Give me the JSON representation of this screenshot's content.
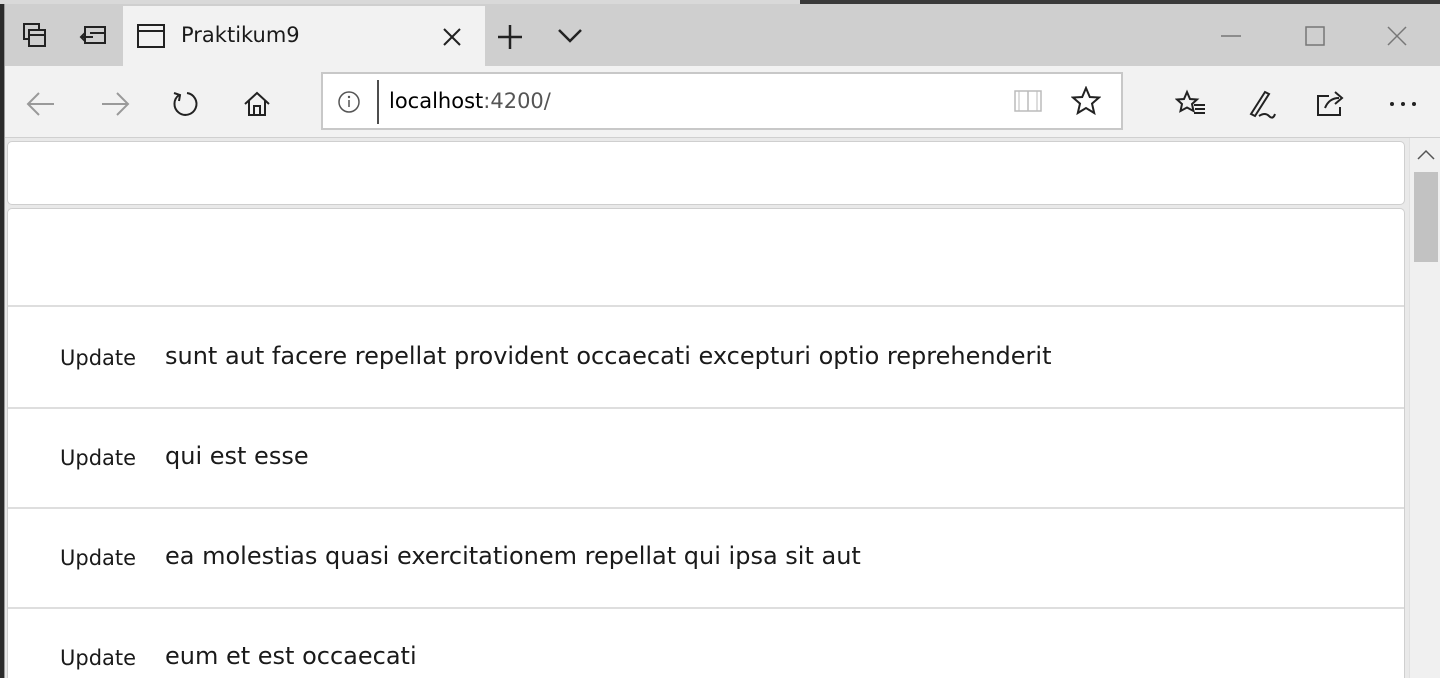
{
  "browser": {
    "tab": {
      "title": "Praktikum9"
    },
    "address": {
      "host": "localhost",
      "port": ":4200/"
    }
  },
  "posts": [
    {
      "action": "Update",
      "title": "sunt aut facere repellat provident occaecati excepturi optio reprehenderit"
    },
    {
      "action": "Update",
      "title": "qui est esse"
    },
    {
      "action": "Update",
      "title": "ea molestias quasi exercitationem repellat qui ipsa sit aut"
    },
    {
      "action": "Update",
      "title": "eum et est occaecati"
    }
  ]
}
